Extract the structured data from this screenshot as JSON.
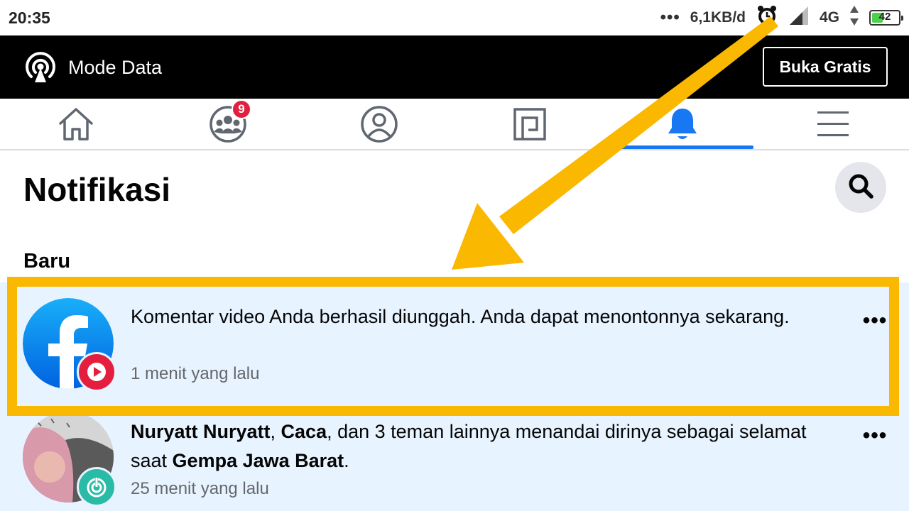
{
  "status_bar": {
    "time": "20:35",
    "dots": "•••",
    "speed": "6,1KB/d",
    "network": "4G",
    "battery": "42",
    "battery_level_percent": 42,
    "icons": [
      "alarm-clock-icon",
      "signal-strength-icon",
      "data-transfer-icon",
      "battery-icon"
    ]
  },
  "data_bar": {
    "label": "Mode Data",
    "button_label": "Buka Gratis",
    "icon": "broadcast-icon",
    "background": "#000000"
  },
  "nav": {
    "items": [
      {
        "id": "home",
        "icon": "home-icon"
      },
      {
        "id": "groups",
        "icon": "groups-icon",
        "badge": "9"
      },
      {
        "id": "profile",
        "icon": "profile-icon"
      },
      {
        "id": "pages",
        "icon": "pages-icon"
      },
      {
        "id": "notifications",
        "icon": "bell-icon",
        "active": true
      },
      {
        "id": "menu",
        "icon": "hamburger-menu-icon"
      }
    ],
    "active_color": "#1877f2",
    "badge_color": "#e41e3f"
  },
  "page": {
    "title": "Notifikasi",
    "section_title": "Baru"
  },
  "notifications": [
    {
      "text": "Komentar video Anda berhasil diunggah. Anda dapat menontonnya sekarang.",
      "time": "1 menit yang lalu",
      "avatar": "facebook-logo",
      "sub_icon": "play-icon",
      "sub_icon_color": "#e41e3f",
      "unread": true
    },
    {
      "name_1": "Nuryatt Nuryatt",
      "sep_1": ", ",
      "name_2": "Caca",
      "text_mid": ", dan 3 teman lainnya menandai dirinya sebagai selamat saat ",
      "event": "Gempa Jawa Barat",
      "text_end": ".",
      "time": "25 menit yang lalu",
      "avatar": "user-photo",
      "sub_icon": "safety-check-icon",
      "sub_icon_color": "#2abba7",
      "unread": true
    }
  ],
  "annotation": {
    "color": "#fbb800"
  }
}
